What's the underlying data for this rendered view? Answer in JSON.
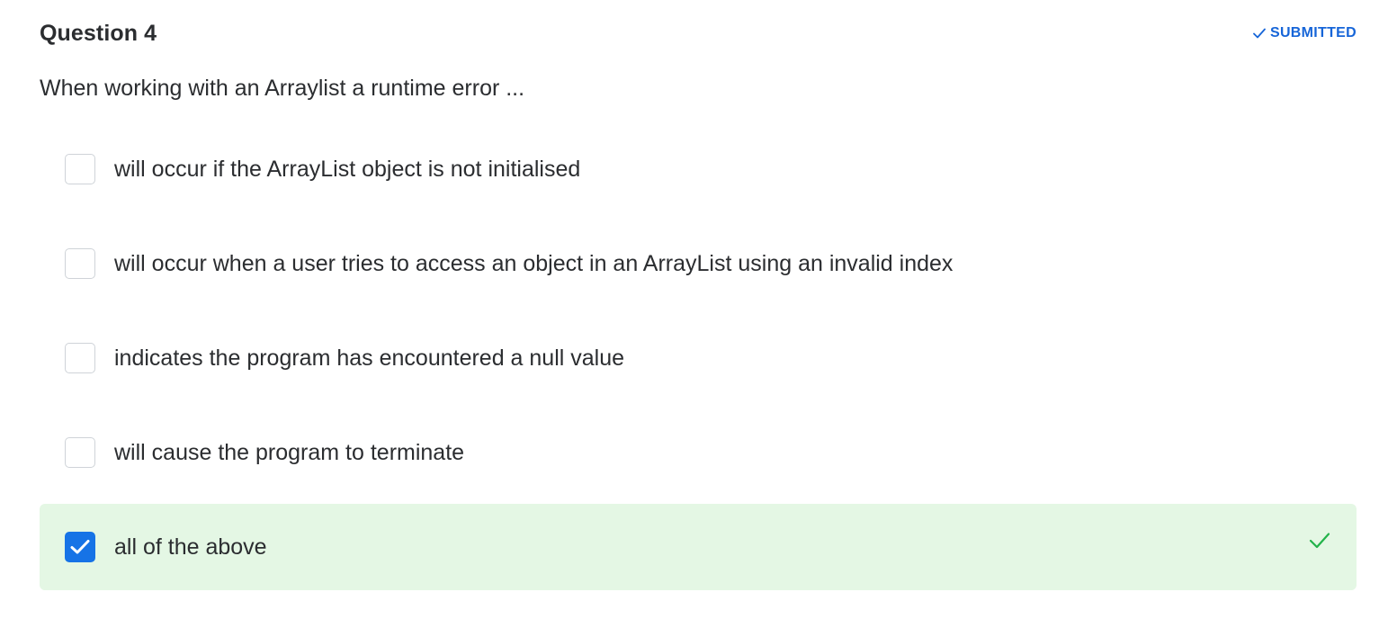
{
  "question": {
    "title": "Question 4",
    "status": "SUBMITTED",
    "status_icon": "check-icon",
    "prompt": "When working with an Arraylist a runtime error ..."
  },
  "options": [
    {
      "label": "will occur if the ArrayList object is not initialised",
      "checked": false
    },
    {
      "label": "will occur when a user tries to access an object in an ArrayList using an invalid index",
      "checked": false
    },
    {
      "label": "indicates the program has encountered a null value",
      "checked": false
    },
    {
      "label": "will cause the program to terminate",
      "checked": false
    },
    {
      "label": "all of the above",
      "checked": true,
      "result": "correct"
    }
  ],
  "colors": {
    "accent": "#1673e6",
    "status_text": "#1665d8",
    "correct_bg": "#e4f7e4",
    "correct_check": "#22b34a",
    "text": "#2b2d30"
  }
}
